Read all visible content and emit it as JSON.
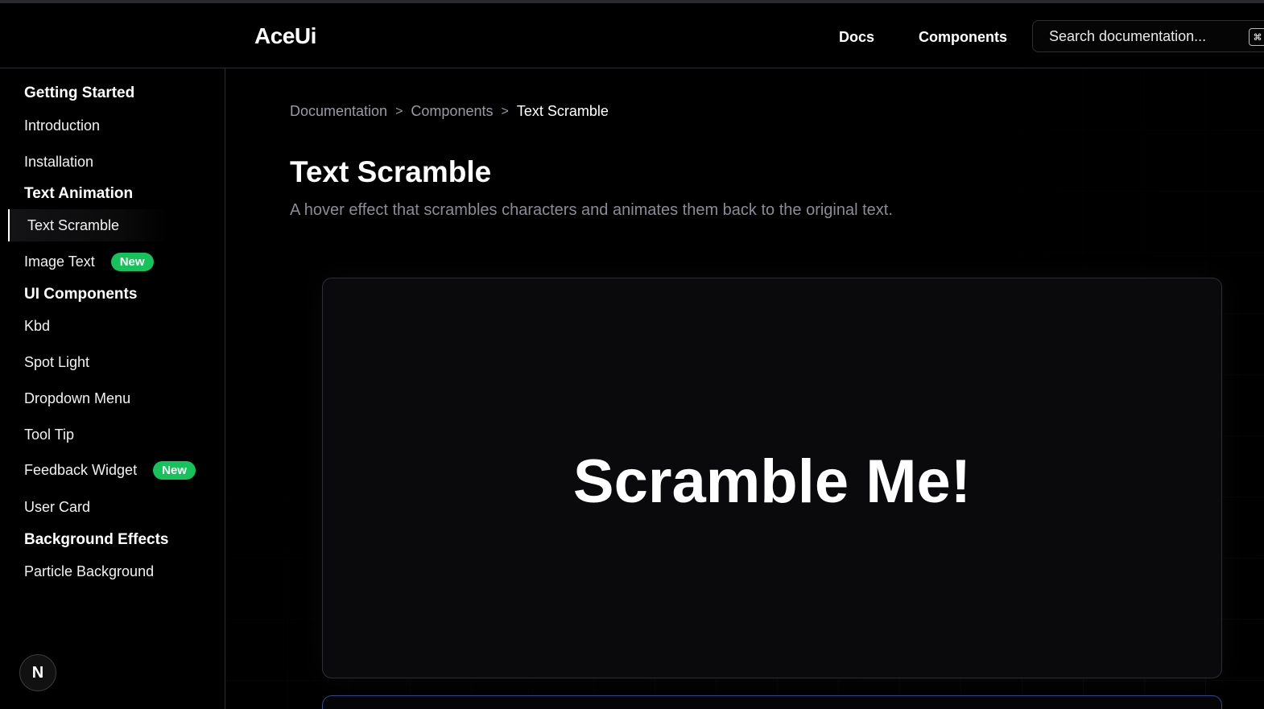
{
  "header": {
    "logo": "AceUi",
    "nav": [
      {
        "label": "Docs"
      },
      {
        "label": "Components"
      }
    ],
    "search": {
      "placeholder": "Search documentation...",
      "shortcut": "⌘"
    }
  },
  "sidebar": {
    "sections": [
      {
        "title": "Getting Started",
        "items": [
          {
            "label": "Introduction"
          },
          {
            "label": "Installation"
          }
        ]
      },
      {
        "title": "Text Animation",
        "items": [
          {
            "label": "Text Scramble",
            "active": true
          },
          {
            "label": "Image Text",
            "badge": "New"
          }
        ]
      },
      {
        "title": "UI Components",
        "items": [
          {
            "label": "Kbd"
          },
          {
            "label": "Spot Light"
          },
          {
            "label": "Dropdown Menu"
          },
          {
            "label": "Tool Tip"
          },
          {
            "label": "Feedback Widget",
            "badge": "New"
          },
          {
            "label": "User Card"
          }
        ]
      },
      {
        "title": "Background Effects",
        "items": [
          {
            "label": "Particle Background"
          }
        ]
      }
    ],
    "footer_button": "N"
  },
  "breadcrumb": {
    "items": [
      "Documentation",
      "Components",
      "Text Scramble"
    ],
    "separator": ">"
  },
  "page": {
    "title": "Text Scramble",
    "description": "A hover effect that scrambles characters and animates them back to the original text.",
    "preview_text": "Scramble Me!"
  },
  "colors": {
    "badge": "#16c25a",
    "background": "#000000",
    "muted_text": "#8b8b97"
  }
}
